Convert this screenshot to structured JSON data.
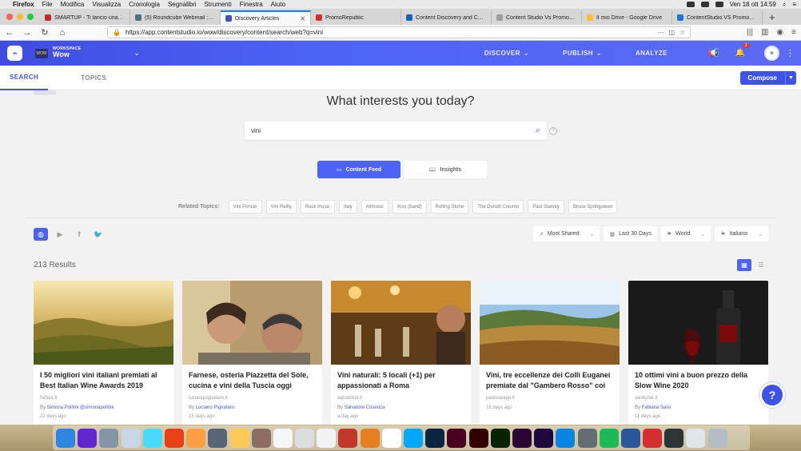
{
  "menubar": {
    "app": "Firefox",
    "items": [
      "File",
      "Modifica",
      "Visualizza",
      "Cronologia",
      "Segnalibri",
      "Strumenti",
      "Finestra",
      "Aiuto"
    ],
    "clock": "Ven 18 ott  14:59"
  },
  "tabs": [
    {
      "title": "SMARTUP - Ti lancio una pia",
      "color": "#c62828"
    },
    {
      "title": "(5) Roundcube Webmail :: Pu",
      "color": "#546e7a"
    },
    {
      "title": "Discovery Articles",
      "color": "#3f51b5"
    },
    {
      "title": "PromoRepublic",
      "color": "#d32f2f"
    },
    {
      "title": "Content Discovery and Curati",
      "color": "#1565c0"
    },
    {
      "title": "Content Studio Vs Promorepublic",
      "color": "#9e9e9e"
    },
    {
      "title": "Il mio Drive - Google Drive",
      "color": "#fbc02d"
    },
    {
      "title": "ContentStudio VS PromoRep",
      "color": "#1976d2"
    }
  ],
  "browser": {
    "url": "https://app.contentstudio.io/wow/discovery/content/search/web?q=vini"
  },
  "app": {
    "workspace_label": "WORKSPACE",
    "workspace_name": "Wow",
    "workspace_thumb": "WOW",
    "nav": [
      "DISCOVER",
      "PUBLISH",
      "ANALYZE"
    ],
    "notification_count": "1",
    "accent": "#4d63f5"
  },
  "subnav": {
    "search": "SEARCH",
    "topics": "TOPICS",
    "compose": "Compose"
  },
  "hero": {
    "title": "What interests you today?",
    "query": "vini"
  },
  "toggles": {
    "content_feed": "Content Feed",
    "insights": "Insights"
  },
  "related": {
    "label": "Related Topics:",
    "topics": [
      "Vini Poncie",
      "Vini Reilly",
      "Rock music",
      "Italy",
      "Allmusic",
      "Kiss (band)",
      "Rolling Stone",
      "The Durutti Column",
      "Paul Stanley",
      "Bruce Springsteen"
    ]
  },
  "filters": {
    "sort": "Most Shared",
    "date": "Last 30 Days",
    "region": "World",
    "language": "Italiano"
  },
  "results": {
    "count": "213 Results"
  },
  "articles": [
    {
      "title": "I 50 migliori vini italiani premiati al Best Italian Wine Awards 2019",
      "domain": "forbes.it",
      "by": "By",
      "author": "Simona Politini  @simonapolitini",
      "age": "22 days ago",
      "img": "vineyard-hills"
    },
    {
      "title": "Farnese, osteria Piazzetta del Sole, cucina e vini della Tuscia oggi anch...",
      "domain": "lucianopignataro.it",
      "by": "By",
      "author": "Luciano Pignataro",
      "age": "15 days ago",
      "img": "people-selfie"
    },
    {
      "title": "Vini naturali: 5 locali (+1) per appassionati a Roma",
      "domain": "agrodolce.it",
      "by": "By",
      "author": "Salvatore Cosenza",
      "age": "a day ago",
      "img": "wine-bar"
    },
    {
      "title": "Vini, tre eccellenze dei Colli Euganei premiate dal \"Gambero Rosso\" coi T...",
      "domain": "padovaoggi.it",
      "by": "",
      "author": "",
      "age": "16 days ago",
      "img": "autumn-vineyard"
    },
    {
      "title": "10 ottimi vini a buon prezzo della Slow Wine 2020",
      "domain": "vanityfair.it",
      "by": "By",
      "author": "Fabiana Salsi",
      "age": "11 days ago",
      "img": "wine-bottle"
    }
  ],
  "dock": [
    {
      "name": "finder",
      "color": "#2e86de"
    },
    {
      "name": "siri",
      "color": "#5f27cd"
    },
    {
      "name": "launchpad",
      "color": "#8395a7"
    },
    {
      "name": "notes-app",
      "color": "#c8d6e5"
    },
    {
      "name": "safari",
      "color": "#48dbfb"
    },
    {
      "name": "chrome",
      "color": "#e84118"
    },
    {
      "name": "firefox",
      "color": "#ff9f43"
    },
    {
      "name": "app-hex",
      "color": "#576574"
    },
    {
      "name": "pineapple",
      "color": "#feca57"
    },
    {
      "name": "books",
      "color": "#8d6e63"
    },
    {
      "name": "calendar",
      "color": "#f5f6fa"
    },
    {
      "name": "textedit",
      "color": "#dcdde1"
    },
    {
      "name": "reminders",
      "color": "#f1f2f6"
    },
    {
      "name": "filezilla",
      "color": "#c0392b"
    },
    {
      "name": "sublime",
      "color": "#e67e22"
    },
    {
      "name": "slack",
      "color": "#ffffff"
    },
    {
      "name": "skype",
      "color": "#00a8ff"
    },
    {
      "name": "photoshop",
      "color": "#0a2540"
    },
    {
      "name": "indesign",
      "color": "#49021f"
    },
    {
      "name": "illustrator",
      "color": "#330000"
    },
    {
      "name": "dreamweaver",
      "color": "#072401"
    },
    {
      "name": "premiere",
      "color": "#2a0634"
    },
    {
      "name": "after-effects",
      "color": "#1f0740"
    },
    {
      "name": "app-store",
      "color": "#0984e3"
    },
    {
      "name": "system-prefs",
      "color": "#636e72"
    },
    {
      "name": "spotify",
      "color": "#1db954"
    },
    {
      "name": "word",
      "color": "#2b579a"
    },
    {
      "name": "acrobat",
      "color": "#d32f2f"
    },
    {
      "name": "inkscape",
      "color": "#2d3436"
    },
    {
      "name": "preview",
      "color": "#dfe6e9"
    },
    {
      "name": "trash",
      "color": "#b2bec3"
    }
  ]
}
